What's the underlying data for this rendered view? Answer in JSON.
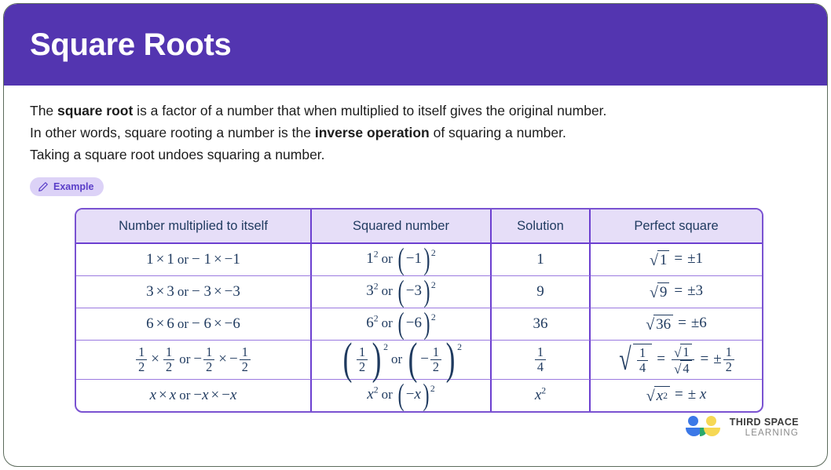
{
  "banner": {
    "title": "Square Roots",
    "color": "#5335B0"
  },
  "intro": {
    "line1_a": "The ",
    "line1_b": "square root",
    "line1_c": " is a factor of a number that when multiplied to itself gives the original number.",
    "line2_a": "In other words, square rooting a number is the ",
    "line2_b": "inverse operation",
    "line2_c": " of squaring a number.",
    "line3": "Taking a square root undoes squaring a number."
  },
  "example_badge": {
    "label": "Example",
    "icon": "pencil-icon",
    "color": "#5a3ec8",
    "background": "#DCD2F7"
  },
  "table": {
    "border_color": "#6c3fd0",
    "header_background": "#E6DEF8",
    "text_color": "#1f3a5f",
    "headers": [
      "Number multiplied to itself",
      "Squared number",
      "Solution",
      "Perfect square"
    ],
    "rows": [
      {
        "multiplied": "1 × 1 or − 1 × −1",
        "squared": "1² or (−1)²",
        "solution": "1",
        "perfect_square": "√1 = ±1"
      },
      {
        "multiplied": "3 × 3 or − 3 × −3",
        "squared": "3² or (−3)²",
        "solution": "9",
        "perfect_square": "√9 = ±3"
      },
      {
        "multiplied": "6 × 6 or − 6 × −6",
        "squared": "6² or (−6)²",
        "solution": "36",
        "perfect_square": "√36 = ±6"
      },
      {
        "multiplied": "1/2 × 1/2 or − 1/2 × −1/2",
        "squared": "(1/2)² or (−1/2)²",
        "solution": "1/4",
        "perfect_square": "√(1/4) = √1/√4 = ±1/2"
      },
      {
        "multiplied": "x × x or −x × −x",
        "squared": "x² or (−x)²",
        "solution": "x²",
        "perfect_square": "√(x²) = ± x"
      }
    ],
    "symbols": {
      "times": "×",
      "minus": "−",
      "or": "or",
      "equals": "=",
      "plusminus": "±",
      "radical": "√",
      "one": "1",
      "two": "2",
      "three": "3",
      "four": "4",
      "six": "6",
      "nine": "9",
      "thirtysix": "36",
      "x": "x"
    }
  },
  "logo": {
    "line1": "THIRD SPACE",
    "line2": "LEARNING"
  }
}
